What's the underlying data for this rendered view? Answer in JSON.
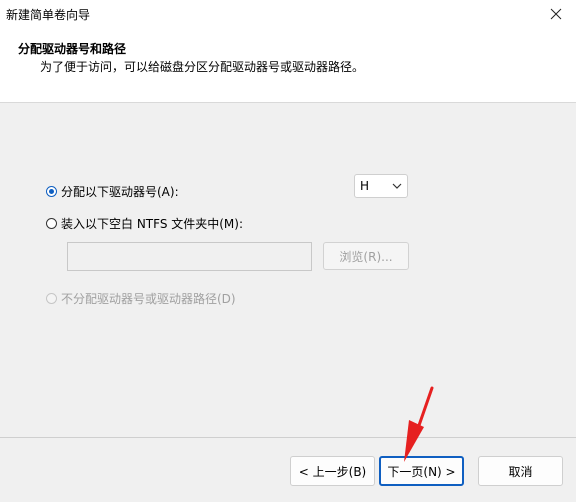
{
  "window": {
    "title": "新建简单卷向导"
  },
  "header": {
    "title": "分配驱动器号和路径",
    "subtitle": "为了便于访问，可以给磁盘分区分配驱动器号或驱动器路径。"
  },
  "options": {
    "assign_letter_label": "分配以下驱动器号(A):",
    "drive_letter_value": "H",
    "mount_folder_label": "装入以下空白 NTFS 文件夹中(M):",
    "browse_label": "浏览(R)...",
    "no_assign_label": "不分配驱动器号或驱动器路径(D)"
  },
  "buttons": {
    "back": "< 上一步(B)",
    "next": "下一页(N) >",
    "cancel": "取消"
  },
  "colors": {
    "accent": "#0f5fc1",
    "annotation_arrow": "#e62020"
  }
}
